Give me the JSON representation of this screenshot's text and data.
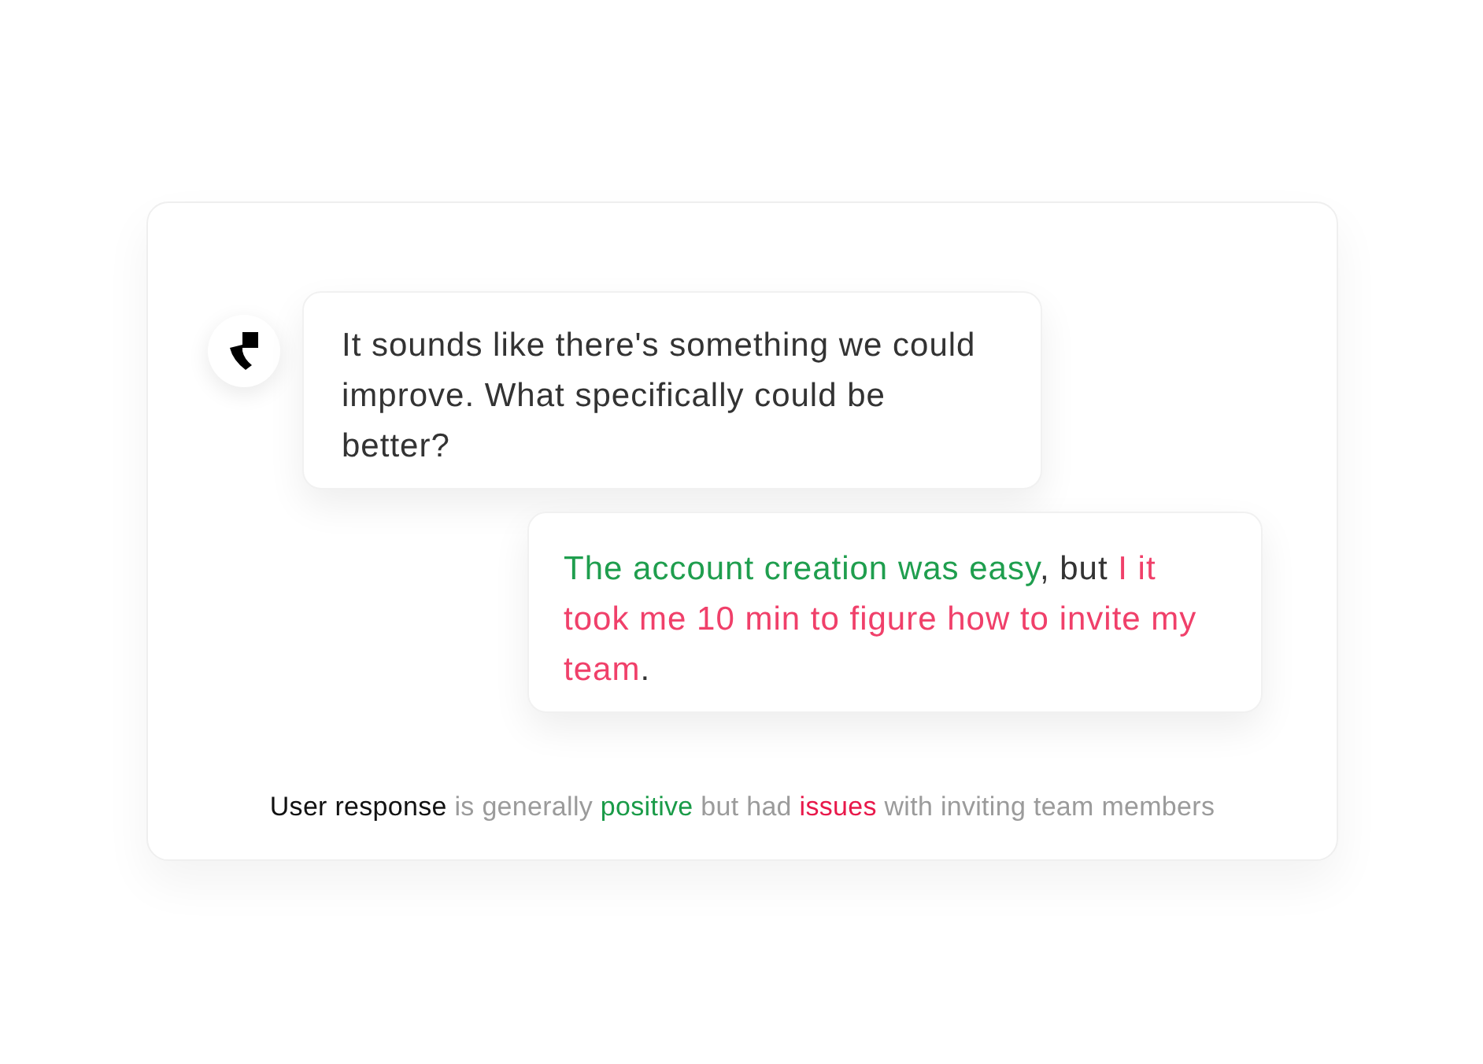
{
  "assistant": {
    "message": "It sounds like there's something we could improve. What specifically could be better?"
  },
  "reply": {
    "segments": [
      {
        "text": "The account creation was easy",
        "kind": "positive"
      },
      {
        "text": ", but ",
        "kind": "plain"
      },
      {
        "text": "I it took me 10 min to figure how to invite my team",
        "kind": "negative"
      },
      {
        "text": ".",
        "kind": "plain"
      }
    ]
  },
  "summary": {
    "segments": [
      {
        "text": "User response",
        "kind": "subject"
      },
      {
        "text": " is generally ",
        "kind": "plain"
      },
      {
        "text": "positive",
        "kind": "positive"
      },
      {
        "text": " but had ",
        "kind": "plain"
      },
      {
        "text": "issues",
        "kind": "negative"
      },
      {
        "text": " with inviting team members",
        "kind": "plain"
      }
    ]
  }
}
